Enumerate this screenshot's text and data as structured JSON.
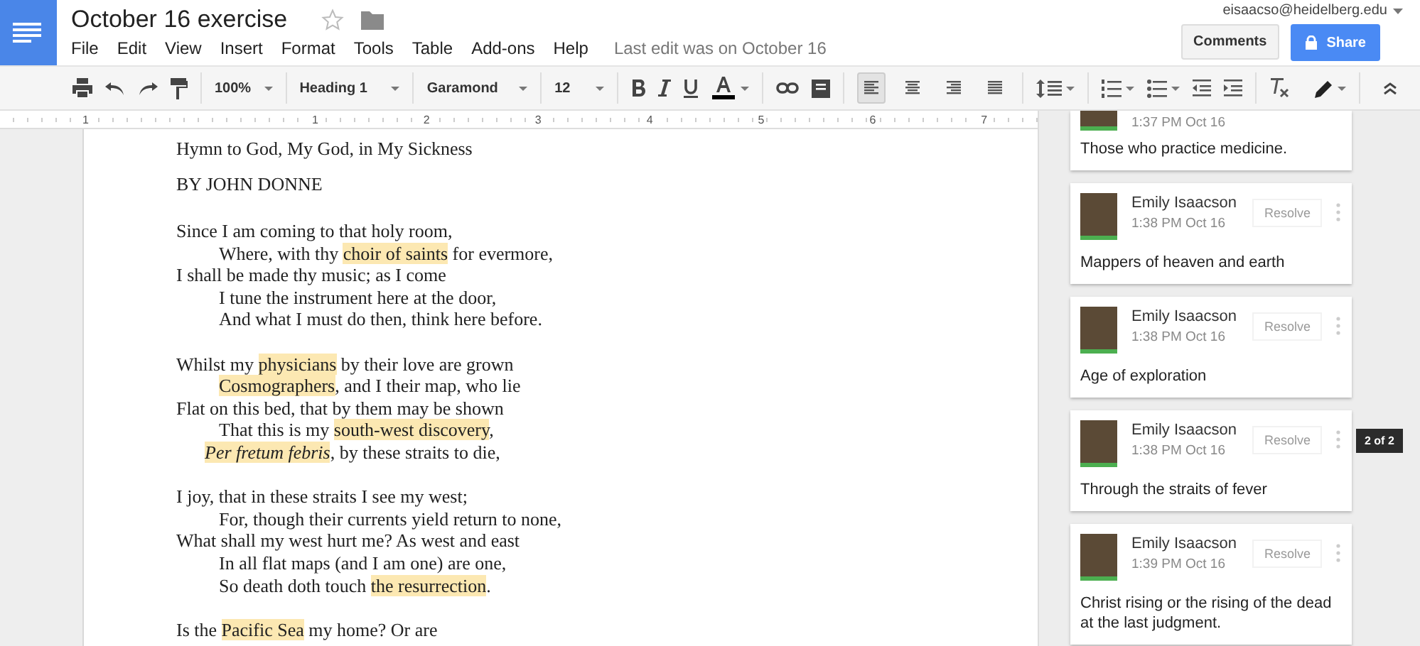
{
  "document": {
    "title": "October 16 exercise",
    "starred": false,
    "last_edit": "Last edit was on October 16"
  },
  "menu": [
    "File",
    "Edit",
    "View",
    "Insert",
    "Format",
    "Tools",
    "Table",
    "Add-ons",
    "Help"
  ],
  "account": {
    "email": "eisaacso@heidelberg.edu"
  },
  "buttons": {
    "comments": "Comments",
    "share": "Share"
  },
  "toolbar": {
    "zoom": "100%",
    "style": "Heading 1",
    "font": "Garamond",
    "size": "12",
    "align": [
      {
        "kind": "left",
        "selected": true
      },
      {
        "kind": "center",
        "selected": false
      },
      {
        "kind": "right",
        "selected": false
      },
      {
        "kind": "justify",
        "selected": false
      }
    ]
  },
  "ruler": [
    "1",
    "1",
    "2",
    "3",
    "4",
    "5",
    "6",
    "7"
  ],
  "poem": {
    "title": "Hymn to God, My God, in My Sickness",
    "byline": "BY JOHN DONNE",
    "stanzas": [
      {
        "lines": [
          {
            "kind": "flush",
            "segments": [
              {
                "text": "Since I am coming to that holy room,",
                "highlighted": false
              }
            ]
          },
          {
            "kind": "indented",
            "segments": [
              {
                "text": "Where, with thy ",
                "highlighted": false
              },
              {
                "text": "choir of saints",
                "highlighted": true
              },
              {
                "text": " for evermore,",
                "highlighted": false
              }
            ]
          },
          {
            "kind": "flush",
            "segments": [
              {
                "text": "I shall be made thy music; as I come",
                "highlighted": false
              }
            ]
          },
          {
            "kind": "indented",
            "segments": [
              {
                "text": "I tune the instrument here at the door,",
                "highlighted": false
              }
            ]
          },
          {
            "kind": "indented",
            "segments": [
              {
                "text": "And what I must do then, think here before.",
                "highlighted": false
              }
            ]
          }
        ]
      },
      {
        "lines": [
          {
            "kind": "flush",
            "segments": [
              {
                "text": "Whilst my ",
                "highlighted": false
              },
              {
                "text": "physicians",
                "highlighted": true
              },
              {
                "text": " by their love are grown",
                "highlighted": false
              }
            ]
          },
          {
            "kind": "indented",
            "segments": [
              {
                "text": "Cosmographers",
                "highlighted": true
              },
              {
                "text": ", and I their map, who lie",
                "highlighted": false
              }
            ]
          },
          {
            "kind": "flush",
            "segments": [
              {
                "text": "Flat on this bed, that by them may be shown",
                "highlighted": false
              }
            ]
          },
          {
            "kind": "indented",
            "segments": [
              {
                "text": "That this is my ",
                "highlighted": false
              },
              {
                "text": "south-west discovery",
                "highlighted": true
              },
              {
                "text": ",",
                "highlighted": false
              }
            ]
          },
          {
            "kind": "half_indented",
            "segments": [
              {
                "text": "*Per fretum febris*",
                "highlighted": true
              },
              {
                "text": ", by these straits to die,",
                "highlighted": false
              }
            ]
          }
        ]
      },
      {
        "lines": [
          {
            "kind": "flush",
            "segments": [
              {
                "text": "I joy, that in these straits I see my west;",
                "highlighted": false
              }
            ]
          },
          {
            "kind": "indented",
            "segments": [
              {
                "text": "For, though their currents yield return to none,",
                "highlighted": false
              }
            ]
          },
          {
            "kind": "flush",
            "segments": [
              {
                "text": "What shall my west hurt me? As west and east",
                "highlighted": false
              }
            ]
          },
          {
            "kind": "indented",
            "segments": [
              {
                "text": "In all flat maps (and I am one) are one,",
                "highlighted": false
              }
            ]
          },
          {
            "kind": "indented",
            "segments": [
              {
                "text": "So death doth touch ",
                "highlighted": false
              },
              {
                "text": "the resurrection",
                "highlighted": true
              },
              {
                "text": ".",
                "highlighted": false
              }
            ]
          }
        ]
      },
      {
        "lines": [
          {
            "kind": "flush",
            "segments": [
              {
                "text": "Is the ",
                "highlighted": false
              },
              {
                "text": "Pacific Sea",
                "highlighted": true
              },
              {
                "text": " my home? Or are",
                "highlighted": false
              }
            ]
          }
        ]
      }
    ]
  },
  "comments": [
    {
      "time": "1:37 PM Oct 16",
      "text": "Those who practice medicine."
    },
    {
      "author": "Emily Isaacson",
      "time": "1:38 PM Oct 16",
      "resolve": "Resolve",
      "text": "Mappers of heaven and earth"
    },
    {
      "author": "Emily Isaacson",
      "time": "1:38 PM Oct 16",
      "resolve": "Resolve",
      "text": "Age of exploration"
    },
    {
      "author": "Emily Isaacson",
      "time": "1:38 PM Oct 16",
      "resolve": "Resolve",
      "text": "Through the straits of fever",
      "badge": "2 of 2"
    },
    {
      "author": "Emily Isaacson",
      "time": "1:39 PM Oct 16",
      "resolve": "Resolve",
      "text": "Christ rising or the rising of the dead at the last judgment."
    }
  ]
}
